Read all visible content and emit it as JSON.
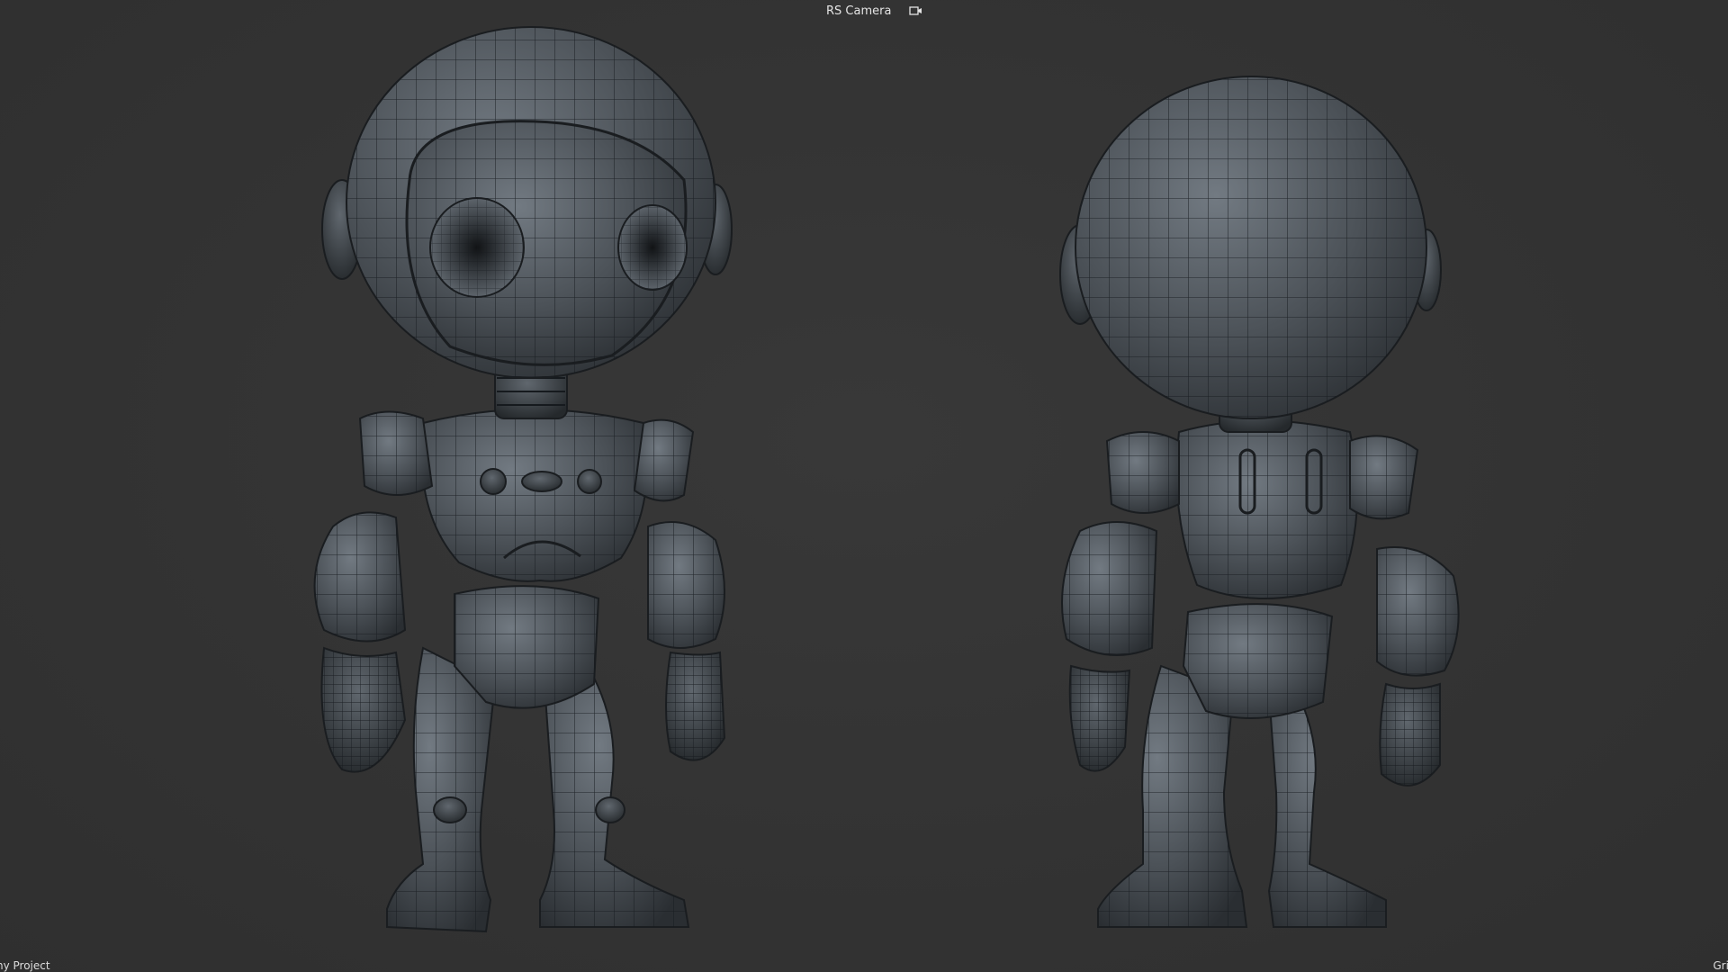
{
  "viewport": {
    "camera_name": "RS Camera",
    "camera_icon": "camera-lock-icon",
    "background_color": "#333333",
    "wire_color": "#161a1e",
    "status_left": "ny Project",
    "status_right": "Grid S"
  },
  "models": [
    {
      "name": "robot-front-view",
      "view": "front"
    },
    {
      "name": "robot-back-view",
      "view": "back"
    }
  ]
}
